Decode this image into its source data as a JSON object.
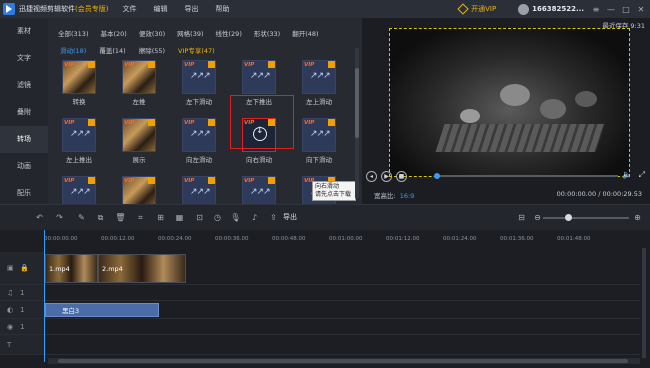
{
  "app": {
    "title": "迅捷视频剪辑软件",
    "edition": "(会员专版)",
    "menu": [
      "文件",
      "编辑",
      "导出",
      "帮助"
    ],
    "vip_button": "开通VIP",
    "username": "166382522...",
    "expiry": "最近保存 9:31"
  },
  "sidebar": {
    "items": [
      {
        "label": "素材"
      },
      {
        "label": "文字"
      },
      {
        "label": "滤镜"
      },
      {
        "label": "叠附"
      },
      {
        "label": "转场"
      },
      {
        "label": "动画"
      },
      {
        "label": "配乐"
      }
    ],
    "active_index": 4
  },
  "library": {
    "categories": [
      "全部(313)",
      "基本(20)",
      "便效(30)",
      "网格(39)",
      "线性(29)",
      "形状(33)",
      "翻开(48)"
    ],
    "subcategories": [
      "滑动(18)",
      "覆盖(14)",
      "擦除(55)",
      "VIP专享(47)"
    ],
    "tiles": [
      {
        "label": "转换",
        "vip": true,
        "kind": "photo"
      },
      {
        "label": "左推",
        "vip": true,
        "kind": "photo"
      },
      {
        "label": "左下滑动",
        "vip": true,
        "kind": "arrows"
      },
      {
        "label": "左下推出",
        "vip": true,
        "kind": "arrows"
      },
      {
        "label": "左上滑动",
        "vip": true,
        "kind": "arrows"
      },
      {
        "label": "左上推出",
        "vip": true,
        "kind": "arrows"
      },
      {
        "label": "展示",
        "vip": true,
        "kind": "photo"
      },
      {
        "label": "向左滑动",
        "vip": true,
        "kind": "arrows"
      },
      {
        "label": "向右滑动",
        "vip": true,
        "kind": "download"
      },
      {
        "label": "向下滑动",
        "vip": true,
        "kind": "arrows"
      },
      {
        "label": "",
        "vip": true,
        "kind": "arrows"
      },
      {
        "label": "",
        "vip": true,
        "kind": "photo"
      },
      {
        "label": "",
        "vip": true,
        "kind": "arrows"
      },
      {
        "label": "",
        "vip": true,
        "kind": "arrows"
      },
      {
        "label": "",
        "vip": true,
        "kind": "arrows"
      }
    ],
    "tooltip": [
      "向右滑动",
      "请先点击下载"
    ]
  },
  "preview": {
    "aspect_label": "宽高比:",
    "aspect_value": "16:9",
    "timecode": "00:00:00.00 / 00:00:29.53",
    "progress": 0.0
  },
  "toolbar": {
    "export_label": "导出"
  },
  "timeline": {
    "ticks": [
      "00:00:00.00",
      "00:00:12.00",
      "00:00:24.00",
      "00:00:36.00",
      "00:00:48.00",
      "00:01:00.00",
      "00:01:12.00",
      "00:01:24.00",
      "00:01:36.00",
      "00:01:48.00"
    ],
    "clips": [
      {
        "label": "1.mp4",
        "track": "video"
      },
      {
        "label": "2.mp4",
        "track": "video"
      },
      {
        "label": "黑白3",
        "track": "filter"
      }
    ],
    "track_labels": [
      "1",
      "1",
      "1"
    ]
  },
  "colors": {
    "accent": "#3a9cf5",
    "vip": "#f0b400",
    "highlight": "#e02020"
  }
}
